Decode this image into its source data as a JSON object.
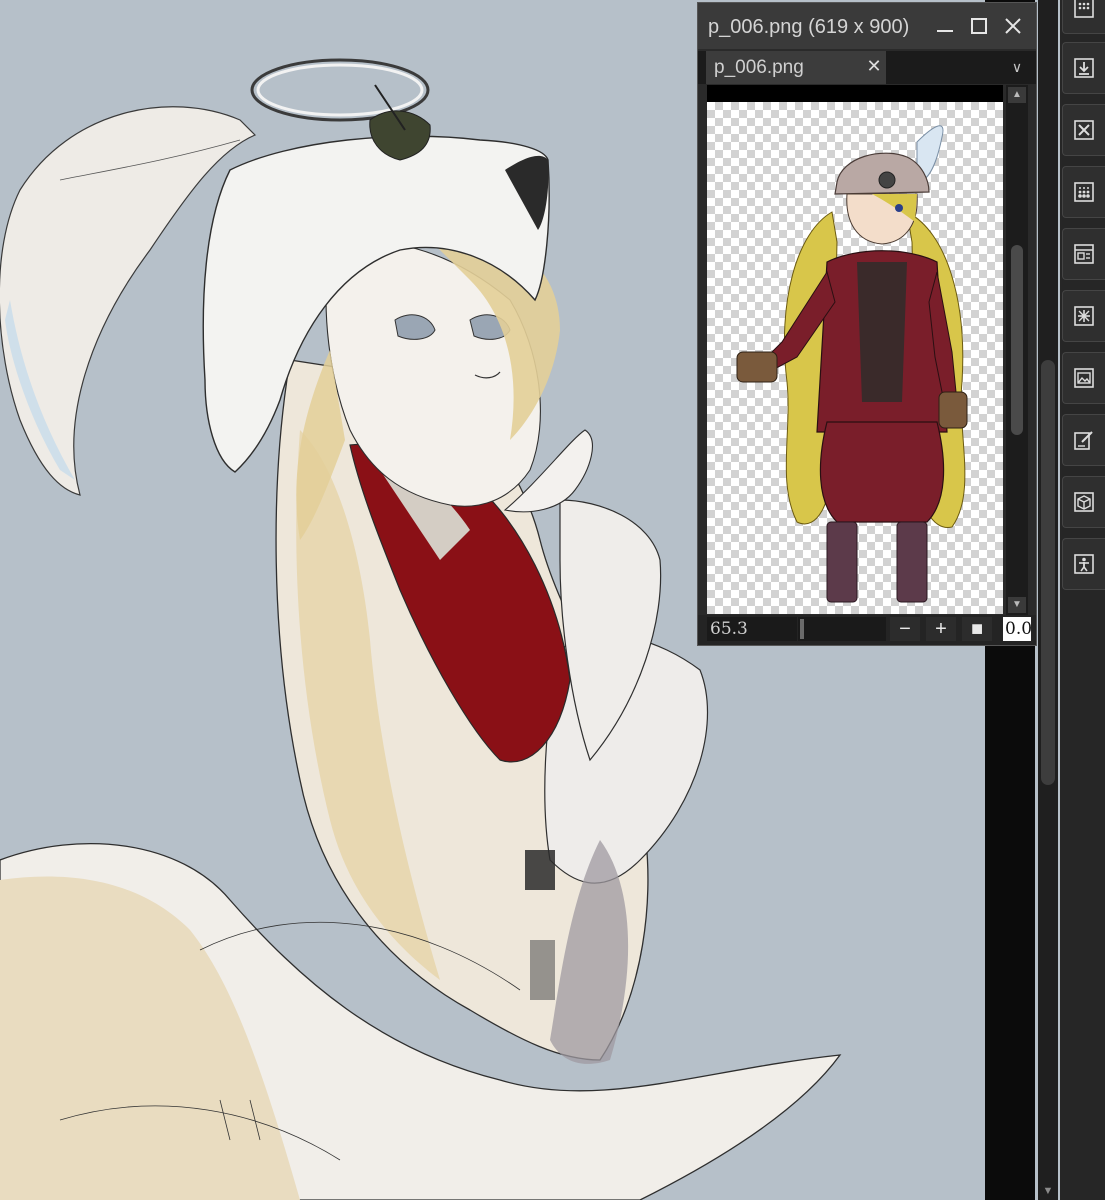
{
  "navigator": {
    "title": "p_006.png (619 x 900)",
    "tab_label": "p_006.png",
    "zoom_value": "65.3",
    "angle_value": "0.0"
  },
  "icons": {
    "window": [
      "minimize-icon",
      "maximize-icon",
      "close-icon"
    ],
    "tab": [
      "tab-close-icon",
      "chevron-down-icon"
    ],
    "nav_controls": [
      "zoom-out-icon",
      "zoom-in-icon",
      "fit-screen-icon"
    ],
    "toolbar": [
      "grid-icon",
      "import-icon",
      "close-file-icon",
      "halftone-icon",
      "layout-icon",
      "transform-icon",
      "image-icon",
      "edit-icon",
      "3d-cube-icon",
      "figure-icon"
    ]
  },
  "colors": {
    "canvas_background": "#b6c0c9",
    "panel_background": "#2a2a2a",
    "toolbar_background": "#262626"
  }
}
